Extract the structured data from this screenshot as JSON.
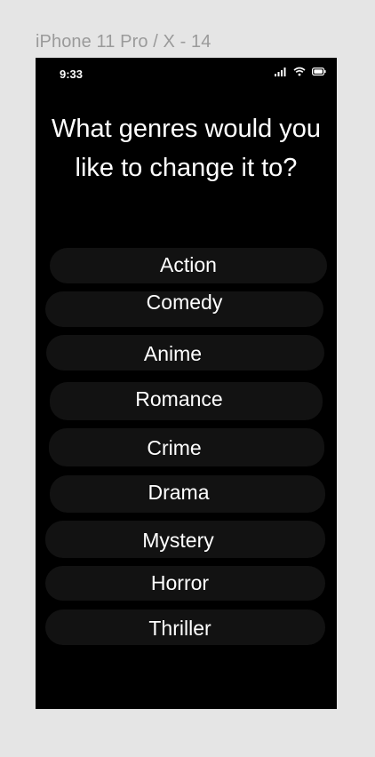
{
  "frame_label": "iPhone 11 Pro / X - 14",
  "status_bar": {
    "time": "9:33",
    "icons": [
      "signal-icon",
      "wifi-icon",
      "battery-icon"
    ]
  },
  "question": "What genres would you like to change it to?",
  "genres": [
    "Action",
    "Comedy",
    "Anime",
    "Romance",
    "Crime",
    "Drama",
    "Mystery",
    "Horror",
    "Thriller"
  ],
  "colors": {
    "canvas": "#e5e5e5",
    "screen": "#000000",
    "pill": "#121212",
    "text": "#ffffff",
    "label": "#9a9a9a"
  }
}
